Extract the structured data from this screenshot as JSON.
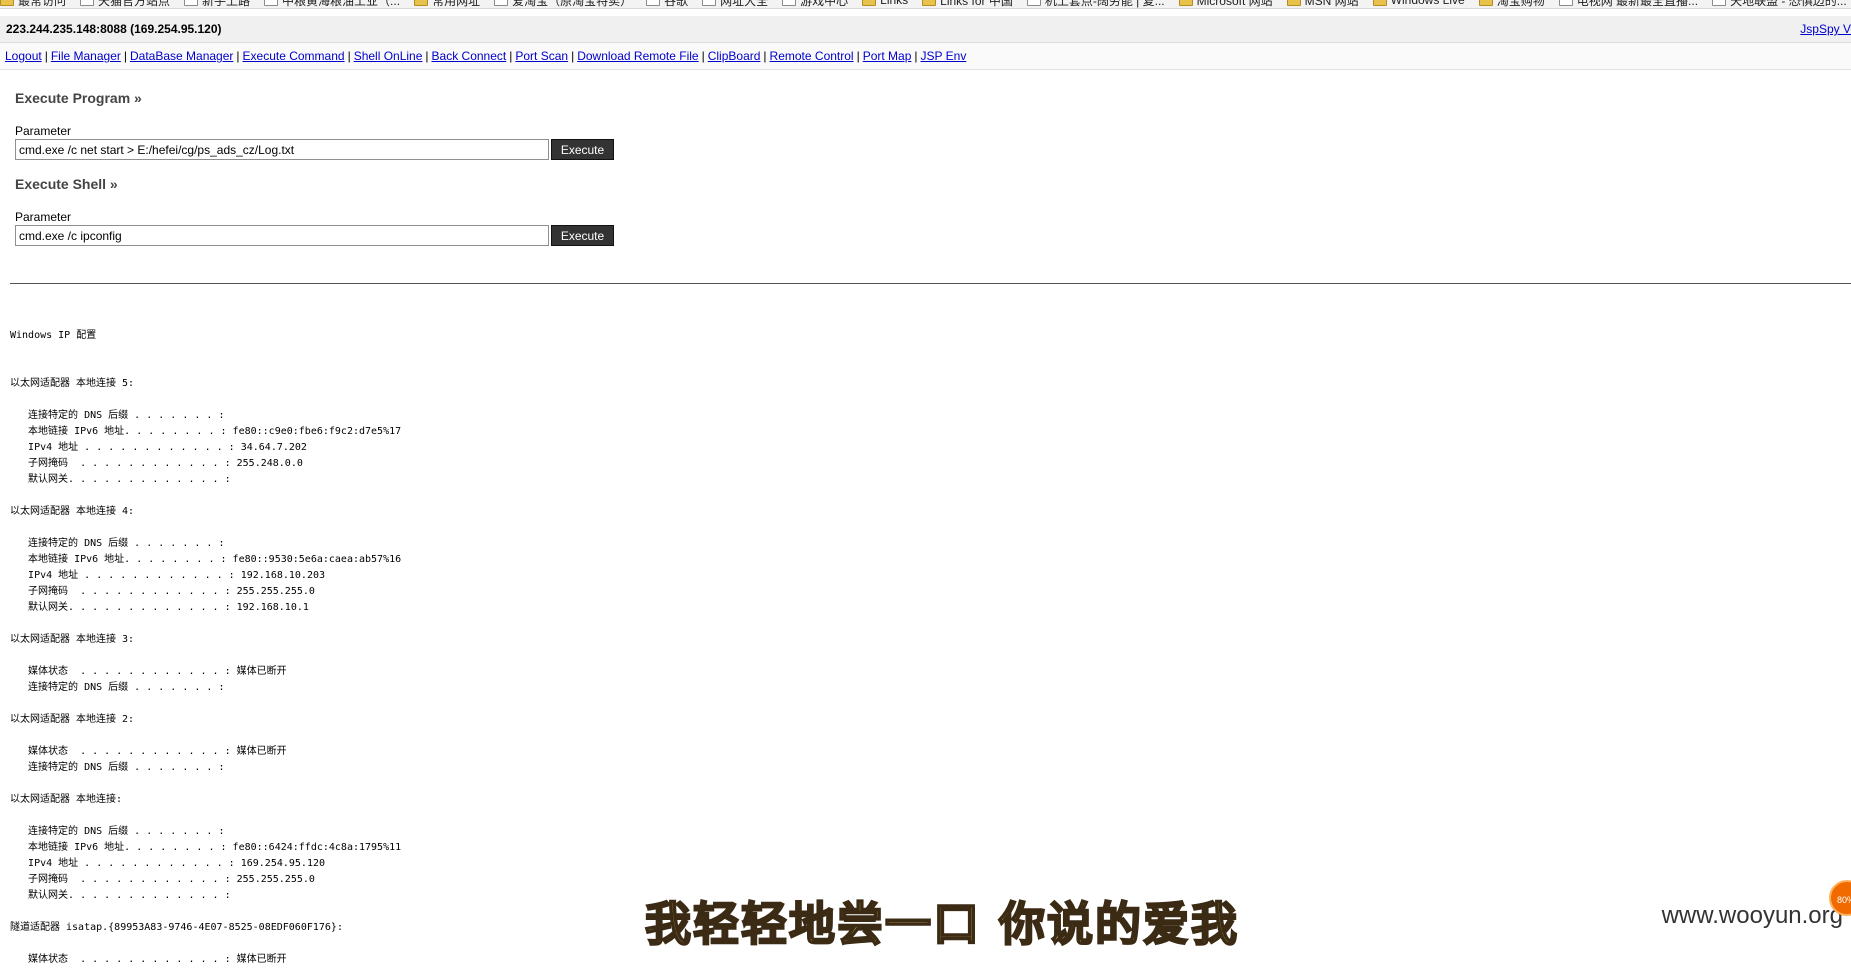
{
  "bookmarks": [
    {
      "label": "最常访问",
      "icon": "folder-icon"
    },
    {
      "label": "天猫官方站点",
      "icon": "page-icon"
    },
    {
      "label": "新手上路",
      "icon": "page-icon"
    },
    {
      "label": "中粮黄海粮油工业（...",
      "icon": "page-icon"
    },
    {
      "label": "常用网址",
      "icon": "folder-icon"
    },
    {
      "label": "爱淘宝（原淘宝特卖）",
      "icon": "page-icon"
    },
    {
      "label": "谷歌",
      "icon": "page-icon"
    },
    {
      "label": "网址大全",
      "icon": "page-icon"
    },
    {
      "label": "游戏中心",
      "icon": "page-icon"
    },
    {
      "label": "Links",
      "icon": "folder-icon"
    },
    {
      "label": "Links for 中国",
      "icon": "folder-icon"
    },
    {
      "label": "机上套点-阔劳能 | 复...",
      "icon": "page-icon"
    },
    {
      "label": "Microsoft 网站",
      "icon": "folder-icon"
    },
    {
      "label": "MSN 网站",
      "icon": "folder-icon"
    },
    {
      "label": "Windows Live",
      "icon": "folder-icon"
    },
    {
      "label": "淘宝购物",
      "icon": "folder-icon"
    },
    {
      "label": "电视网 最新最全直播...",
      "icon": "page-icon"
    },
    {
      "label": "天地联盟 - 恐惧边的...",
      "icon": "page-icon"
    }
  ],
  "host": {
    "address": "223.244.235.148:8088 (169.254.95.120)",
    "brand": "JspSpy Ve"
  },
  "nav": [
    "Logout",
    "File Manager",
    "DataBase Manager",
    "Execute Command",
    "Shell OnLine",
    "Back Connect",
    "Port Scan",
    "Download Remote File",
    "ClipBoard",
    "Remote Control",
    "Port Map",
    "JSP Env"
  ],
  "execute_program": {
    "title": "Execute Program »",
    "param_label": "Parameter",
    "value": "cmd.exe /c net start > E:/hefei/cg/ps_ads_cz/Log.txt",
    "button": "Execute"
  },
  "execute_shell": {
    "title": "Execute Shell »",
    "param_label": "Parameter",
    "value": "cmd.exe /c ipconfig",
    "button": "Execute"
  },
  "output": "\nWindows IP 配置\n\n\n以太网适配器 本地连接 5:\n\n   连接特定的 DNS 后缀 . . . . . . . :\n   本地链接 IPv6 地址. . . . . . . . : fe80::c9e0:fbe6:f9c2:d7e5%17\n   IPv4 地址 . . . . . . . . . . . . : 34.64.7.202\n   子网掩码  . . . . . . . . . . . . : 255.248.0.0\n   默认网关. . . . . . . . . . . . . :\n\n以太网适配器 本地连接 4:\n\n   连接特定的 DNS 后缀 . . . . . . . :\n   本地链接 IPv6 地址. . . . . . . . : fe80::9530:5e6a:caea:ab57%16\n   IPv4 地址 . . . . . . . . . . . . : 192.168.10.203\n   子网掩码  . . . . . . . . . . . . : 255.255.255.0\n   默认网关. . . . . . . . . . . . . : 192.168.10.1\n\n以太网适配器 本地连接 3:\n\n   媒体状态  . . . . . . . . . . . . : 媒体已断开\n   连接特定的 DNS 后缀 . . . . . . . :\n\n以太网适配器 本地连接 2:\n\n   媒体状态  . . . . . . . . . . . . : 媒体已断开\n   连接特定的 DNS 后缀 . . . . . . . :\n\n以太网适配器 本地连接:\n\n   连接特定的 DNS 后缀 . . . . . . . :\n   本地链接 IPv6 地址. . . . . . . . : fe80::6424:ffdc:4c8a:1795%11\n   IPv4 地址 . . . . . . . . . . . . : 169.254.95.120\n   子网掩码  . . . . . . . . . . . . : 255.255.255.0\n   默认网关. . . . . . . . . . . . . :\n\n隧道适配器 isatap.{89953A83-9746-4E07-8525-08EDF060F176}:\n\n   媒体状态  . . . . . . . . . . . . : 媒体已断开",
  "watermark": {
    "caption": "我轻轻地尝一口 你说的爱我",
    "site": "www.wooyun.org",
    "badge": "80%"
  },
  "colors": {
    "link": "#0000cc",
    "button_bg": "#333333",
    "section_title": "#444444"
  }
}
